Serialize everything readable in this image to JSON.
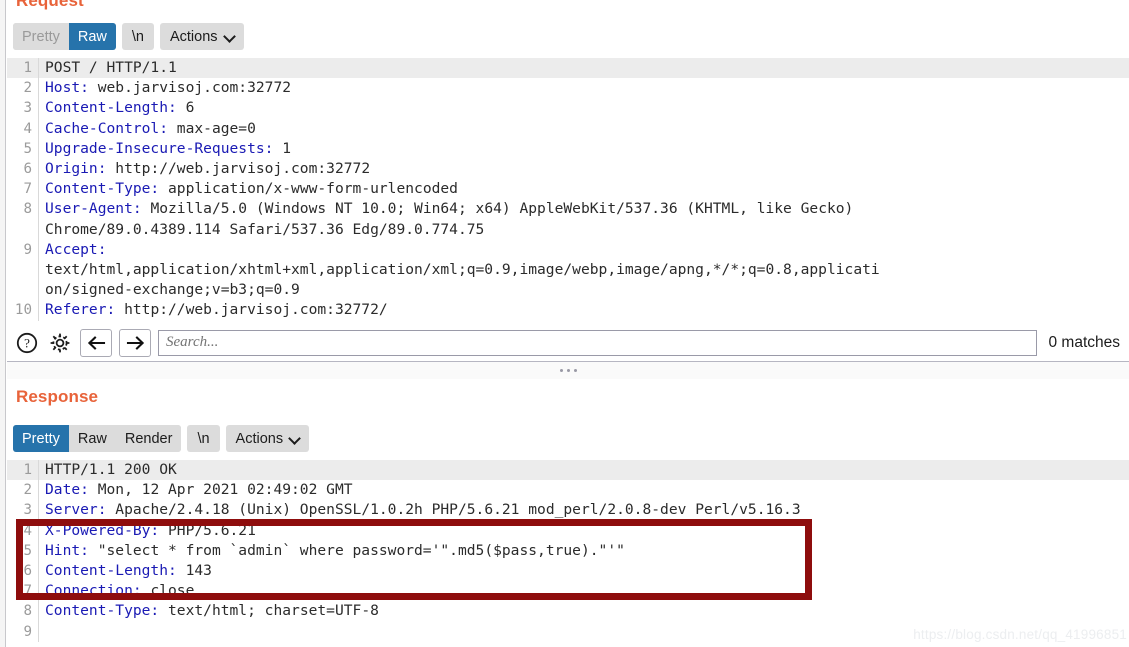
{
  "request": {
    "title": "Request",
    "toolbar": {
      "tabs": [
        {
          "label": "Pretty",
          "active": false
        },
        {
          "label": "Raw",
          "active": true
        }
      ],
      "newline_label": "\\n",
      "actions_label": "Actions"
    },
    "lines": [
      {
        "num": "1",
        "header": "",
        "value": "POST / HTTP/1.1",
        "highlight": true
      },
      {
        "num": "2",
        "header": "Host:",
        "value": " web.jarvisoj.com:32772",
        "highlight": false
      },
      {
        "num": "3",
        "header": "Content-Length:",
        "value": " 6",
        "highlight": false
      },
      {
        "num": "4",
        "header": "Cache-Control:",
        "value": " max-age=0",
        "highlight": false
      },
      {
        "num": "5",
        "header": "Upgrade-Insecure-Requests:",
        "value": " 1",
        "highlight": false
      },
      {
        "num": "6",
        "header": "Origin:",
        "value": " http://web.jarvisoj.com:32772",
        "highlight": false
      },
      {
        "num": "7",
        "header": "Content-Type:",
        "value": " application/x-www-form-urlencoded",
        "highlight": false
      },
      {
        "num": "8",
        "header": "User-Agent:",
        "value": " Mozilla/5.0 (Windows NT 10.0; Win64; x64) AppleWebKit/537.36 (KHTML, like Gecko)",
        "highlight": false
      },
      {
        "num": "",
        "header": "",
        "value": "Chrome/89.0.4389.114 Safari/537.36 Edg/89.0.774.75",
        "highlight": false
      },
      {
        "num": "9",
        "header": "Accept:",
        "value": "",
        "highlight": false
      },
      {
        "num": "",
        "header": "",
        "value": "text/html,application/xhtml+xml,application/xml;q=0.9,image/webp,image/apng,*/*;q=0.8,applicati",
        "highlight": false
      },
      {
        "num": "",
        "header": "",
        "value": "on/signed-exchange;v=b3;q=0.9",
        "highlight": false
      },
      {
        "num": "10",
        "header": "Referer:",
        "value": " http://web.jarvisoj.com:32772/",
        "highlight": false
      }
    ]
  },
  "findbar": {
    "help_icon": "question-mark-icon",
    "settings_icon": "gear-icon",
    "prev_icon": "arrow-left-icon",
    "next_icon": "arrow-right-icon",
    "search_value": "",
    "search_placeholder": "Search...",
    "match_count": "0 matches"
  },
  "response": {
    "title": "Response",
    "toolbar": {
      "tabs": [
        {
          "label": "Pretty",
          "active": true
        },
        {
          "label": "Raw",
          "active": false
        },
        {
          "label": "Render",
          "active": false
        }
      ],
      "newline_label": "\\n",
      "actions_label": "Actions"
    },
    "lines": [
      {
        "num": "1",
        "header": "",
        "value": "HTTP/1.1 200 OK",
        "highlight": true
      },
      {
        "num": "2",
        "header": "Date:",
        "value": " Mon, 12 Apr 2021 02:49:02 GMT",
        "highlight": false
      },
      {
        "num": "3",
        "header": "Server:",
        "value": " Apache/2.4.18 (Unix) OpenSSL/1.0.2h PHP/5.6.21 mod_perl/2.0.8-dev Perl/v5.16.3",
        "highlight": false
      },
      {
        "num": "4",
        "header": "X-Powered-By:",
        "value": " PHP/5.6.21",
        "highlight": false
      },
      {
        "num": "5",
        "header": "Hint:",
        "value": " \"select * from `admin` where password='\".md5($pass,true).\"'\"",
        "highlight": false
      },
      {
        "num": "6",
        "header": "Content-Length:",
        "value": " 143",
        "highlight": false
      },
      {
        "num": "7",
        "header": "Connection:",
        "value": " close",
        "highlight": false
      },
      {
        "num": "8",
        "header": "Content-Type:",
        "value": " text/html; charset=UTF-8",
        "highlight": false
      },
      {
        "num": "9",
        "header": "",
        "value": "",
        "highlight": false
      }
    ]
  },
  "annotation": {
    "box_color": "#8e0d0d"
  },
  "watermark": {
    "text": "https://blog.csdn.net/qq_41996851"
  },
  "colors": {
    "accent_orange": "#e8633a",
    "tab_active_blue": "#2673ab",
    "header_blue": "#1a1ab4"
  }
}
